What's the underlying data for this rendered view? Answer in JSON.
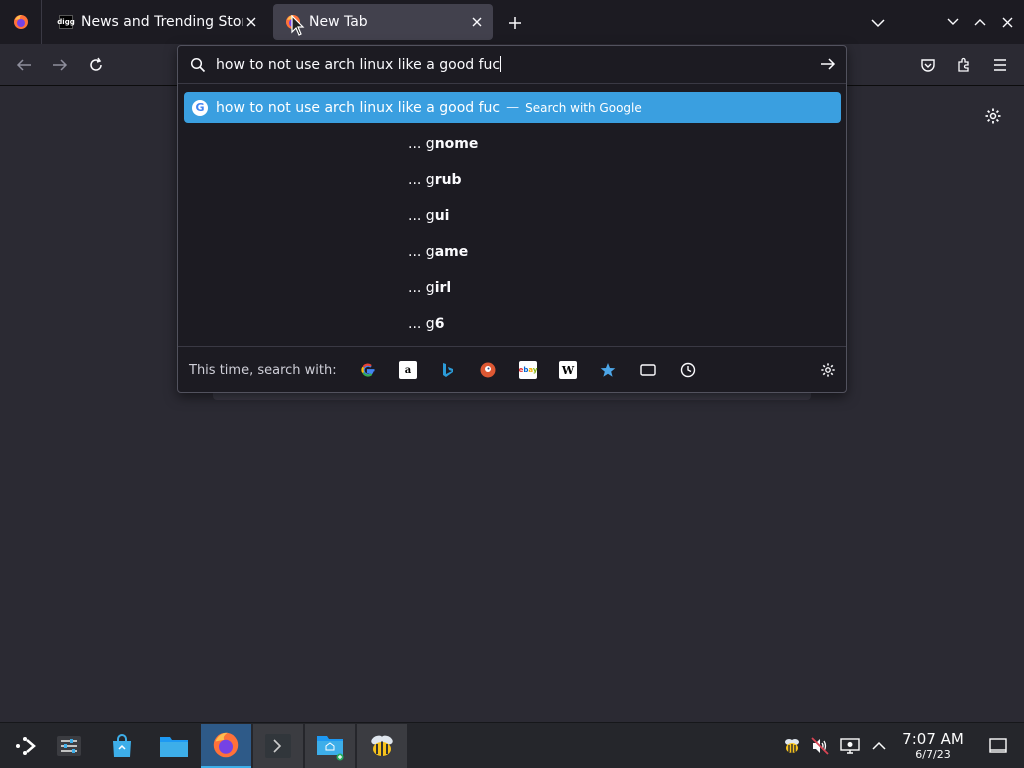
{
  "tabs": [
    {
      "title": "News and Trending Stories",
      "active": false,
      "favicon": "digg",
      "favicon_text": "digg"
    },
    {
      "title": "New Tab",
      "active": true,
      "favicon": "firefox-logo"
    }
  ],
  "urlbar": {
    "query": "how to not use arch linux like a good fuc",
    "heuristic": {
      "text": "how to not use arch linux like a good fuc",
      "separator": "—",
      "action": "Search with Google"
    },
    "suggestions": [
      {
        "prefix": "... g",
        "bold": "nome"
      },
      {
        "prefix": "... g",
        "bold": "rub"
      },
      {
        "prefix": "... g",
        "bold": "ui"
      },
      {
        "prefix": "... g",
        "bold": "ame"
      },
      {
        "prefix": "... g",
        "bold": "irl"
      },
      {
        "prefix": "... g",
        "bold": "6"
      }
    ],
    "oneoff_label": "This time, search with:",
    "engines": [
      "google",
      "amazon",
      "bing",
      "duckduckgo",
      "ebay",
      "wikipedia",
      "bookmarks",
      "tabs",
      "history"
    ]
  },
  "clock": {
    "time": "7:07 AM",
    "date": "6/7/23"
  },
  "colors": {
    "accent": "#3a9fe0",
    "taskbar_active": "#2e5a88",
    "background": "#2b2a33"
  }
}
